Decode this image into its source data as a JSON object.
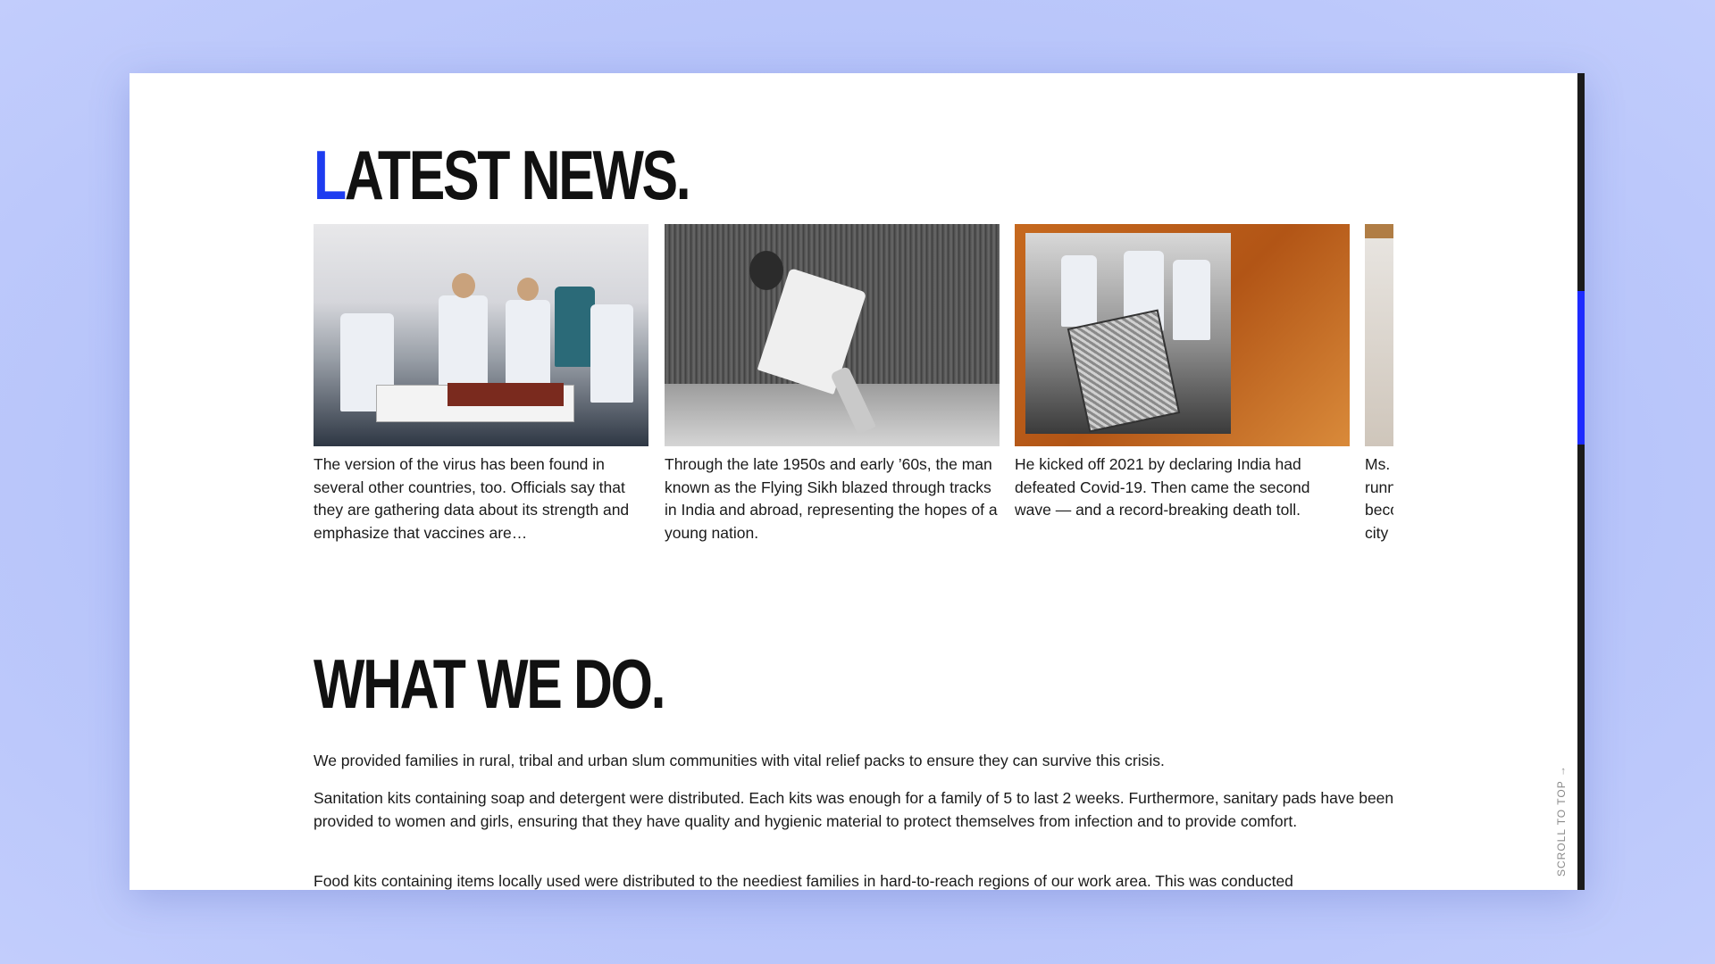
{
  "sections": {
    "latest_news": {
      "title_accent": "L",
      "title_rest": "ATEST NEWS.",
      "cards": [
        {
          "image": "hospital-ward-photo",
          "text": "The version of the virus has been found in several other countries, too. Officials say that they are gathering data about its strength and emphasize that vaccines are…"
        },
        {
          "image": "athlete-running-photo",
          "text": "Through the late 1950s and early ’60s, the man known as the Flying Sikh blazed through tracks in India and abroad, representing the hopes of a young nation."
        },
        {
          "image": "covid-burial-collage",
          "text": "He kicked off 2021 by declaring India had defeated Covid-19. Then came the second wave — and a record-breaking death toll."
        },
        {
          "image": "building-photo",
          "text_lines": [
            "Ms. V",
            "runn",
            "beco",
            "city"
          ]
        }
      ]
    },
    "what_we_do": {
      "title": "WHAT WE DO.",
      "paragraphs": [
        "We provided families in rural, tribal and urban slum communities with vital relief packs to ensure they can survive this crisis.",
        "Sanitation kits containing soap and detergent were distributed. Each kits was enough for a family of 5 to last 2 weeks. Furthermore, sanitary pads have been provided to women and girls, ensuring that they have quality and hygienic material to protect themselves from infection and to provide comfort.",
        "Food kits containing items locally used were distributed to the neediest families in hard-to-reach regions of our work area. This was conducted"
      ]
    }
  },
  "scroll_to_top_label": "SCROLL TO TOP →",
  "colors": {
    "accent": "#1d3cf0",
    "background": "#b7c4fa",
    "text": "#111111",
    "scroll_thumb": "#1e2cff"
  }
}
